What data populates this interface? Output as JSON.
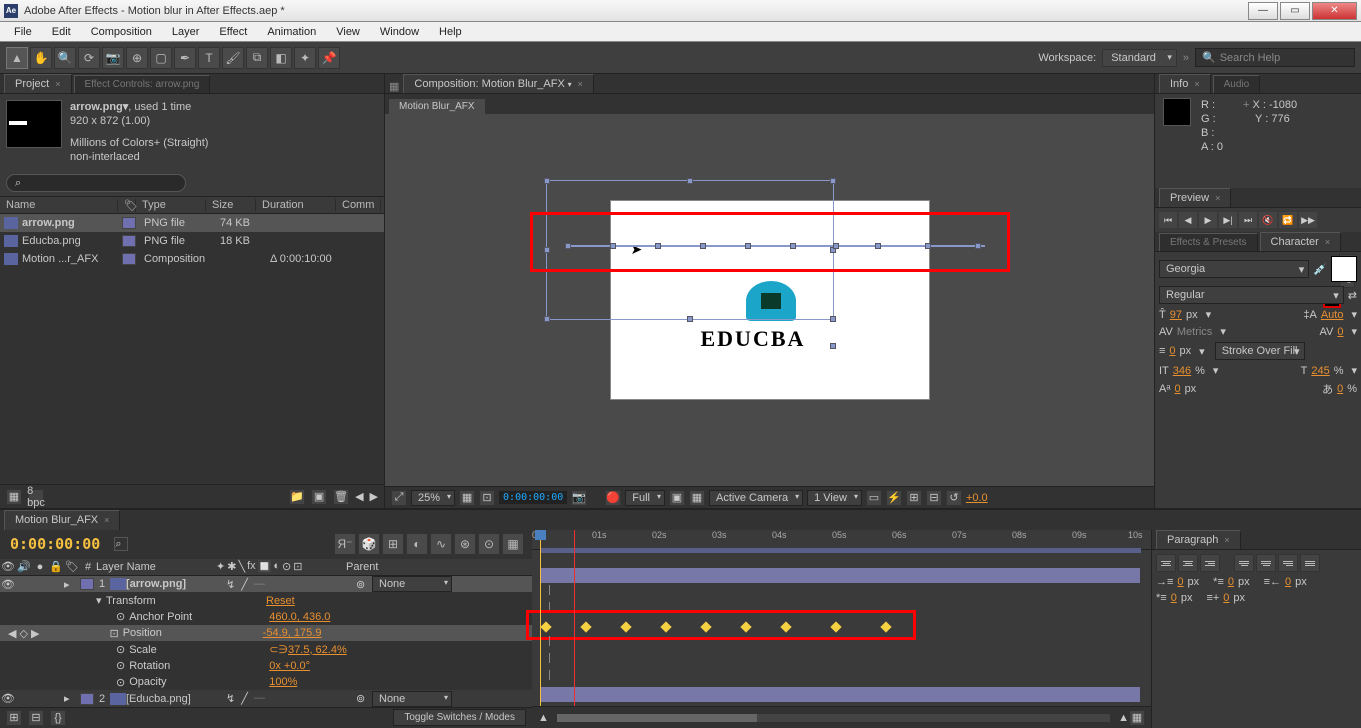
{
  "window": {
    "title": "Adobe After Effects - Motion blur in After Effects.aep *"
  },
  "menu": [
    "File",
    "Edit",
    "Composition",
    "Layer",
    "Effect",
    "Animation",
    "View",
    "Window",
    "Help"
  ],
  "workspace": {
    "label": "Workspace:",
    "value": "Standard",
    "search_placeholder": "Search Help"
  },
  "project": {
    "tab": "Project",
    "efftab": "Effect Controls: arrow.png",
    "asset_name": "arrow.png▾",
    "asset_used": ", used 1 time",
    "asset_dims": "920 x 872 (1.00)",
    "asset_colors": "Millions of Colors+ (Straight)",
    "asset_interlace": "non-interlaced",
    "cols": {
      "name": "Name",
      "type": "Type",
      "size": "Size",
      "duration": "Duration",
      "comment": "Comm"
    },
    "rows": [
      {
        "name": "arrow.png",
        "type": "PNG file",
        "size": "74 KB",
        "duration": "",
        "sel": true
      },
      {
        "name": "Educba.png",
        "type": "PNG file",
        "size": "18 KB",
        "duration": "",
        "sel": false
      },
      {
        "name": "Motion ...r_AFX",
        "type": "Composition",
        "size": "",
        "duration": "Δ 0:00:10:00",
        "sel": false
      }
    ],
    "bpc": "8 bpc"
  },
  "composition": {
    "tab": "Composition: Motion Blur_AFX",
    "subtab": "Motion Blur_AFX",
    "brand": "EDUCBA",
    "zoom": "25%",
    "timecode": "0:00:00:00",
    "res": "Full",
    "camera": "Active Camera",
    "view": "1 View",
    "exposure": "+0.0"
  },
  "info": {
    "tab1": "Info",
    "tab2": "Audio",
    "r": "R :",
    "g": "G :",
    "b": "B :",
    "a": "A : 0",
    "x": "X : -1080",
    "y": "Y : 776"
  },
  "preview": {
    "tab": "Preview"
  },
  "effects": {
    "tab1": "Effects & Presets",
    "tab2": "Character"
  },
  "character": {
    "font": "Georgia",
    "style": "Regular",
    "size": "97",
    "size_u": "px",
    "leading": "Auto",
    "kerning": "Metrics",
    "tracking": "0",
    "stroke": "0",
    "stroke_u": "px",
    "stroke_opt": "Stroke Over Fill",
    "vscale": "346",
    "vscale_u": "%",
    "hscale": "245",
    "hscale_u": "%",
    "baseline": "0",
    "baseline_u": "px",
    "tsume": "0",
    "tsume_u": "%"
  },
  "paragraph": {
    "tab": "Paragraph",
    "indent_left": "0",
    "indent_left_u": "px",
    "indent_right": "0",
    "indent_right_u": "px",
    "indent_first": "0",
    "indent_first_u": "px",
    "space_before": "0",
    "space_before_u": "px",
    "space_after": "0",
    "space_after_u": "px"
  },
  "timeline": {
    "tab": "Motion Blur_AFX",
    "time": "0:00:00:00",
    "ticks": [
      "00s",
      "01s",
      "02s",
      "03s",
      "04s",
      "05s",
      "06s",
      "07s",
      "08s",
      "09s",
      "10s"
    ],
    "col_layer": "Layer Name",
    "col_parent": "Parent",
    "parent_none": "None",
    "layers": [
      {
        "num": "1",
        "name": "[arrow.png]",
        "sel": true
      },
      {
        "num": "2",
        "name": "[Educba.png]",
        "sel": false
      }
    ],
    "props": [
      {
        "name": "Transform",
        "val": "Reset"
      },
      {
        "name": "Anchor Point",
        "val": "460.0, 436.0"
      },
      {
        "name": "Position",
        "val": "-54.9, 175.9",
        "kf": true
      },
      {
        "name": "Scale",
        "val": "37.5, 62.4%"
      },
      {
        "name": "Rotation",
        "val": "0x +0.0°"
      },
      {
        "name": "Opacity",
        "val": "100%"
      }
    ],
    "toggle": "Toggle Switches / Modes"
  }
}
